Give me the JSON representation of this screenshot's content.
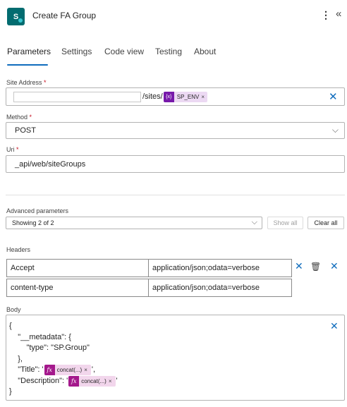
{
  "header": {
    "app_icon_letter": "S",
    "title": "Create FA Group",
    "more_icon": "⋮",
    "collapse_icon": "«"
  },
  "tabs": [
    {
      "label": "Parameters",
      "active": true
    },
    {
      "label": "Settings"
    },
    {
      "label": "Code view"
    },
    {
      "label": "Testing"
    },
    {
      "label": "About"
    }
  ],
  "site_address": {
    "label": "Site Address",
    "required_mark": "*",
    "text": "/sites/",
    "token": {
      "icon": "{x}",
      "label": "SP_ENV",
      "remove": "×"
    },
    "clear_icon": "✕"
  },
  "method": {
    "label": "Method",
    "required_mark": "*",
    "value": "POST",
    "chevron": "⌵"
  },
  "uri": {
    "label": "Uri",
    "required_mark": "*",
    "value": "_api/web/siteGroups"
  },
  "advanced": {
    "label": "Advanced parameters",
    "value": "Showing 2 of 2",
    "chevron": "⌵",
    "show_all": "Show all",
    "clear_all": "Clear all"
  },
  "headers": {
    "label": "Headers",
    "rows": [
      {
        "key": "Accept",
        "value": "application/json;odata=verbose"
      },
      {
        "key": "content-type",
        "value": "application/json;odata=verbose"
      }
    ],
    "remove_icon": "✕",
    "delete_icon": "🗑"
  },
  "body": {
    "label": "Body",
    "lines": [
      "{",
      "    \"__metadata\": {",
      "        \"type\": \"SP.Group\"",
      "    },"
    ],
    "title_prefix": "    \"Title\": '",
    "title_suffix": "',",
    "desc_prefix": "    \"Description\": '",
    "desc_suffix": "'",
    "closing": "}",
    "fx_icon": "fx",
    "concat_label": "concat(...)",
    "token_remove": "×",
    "remove_icon": "✕"
  }
}
